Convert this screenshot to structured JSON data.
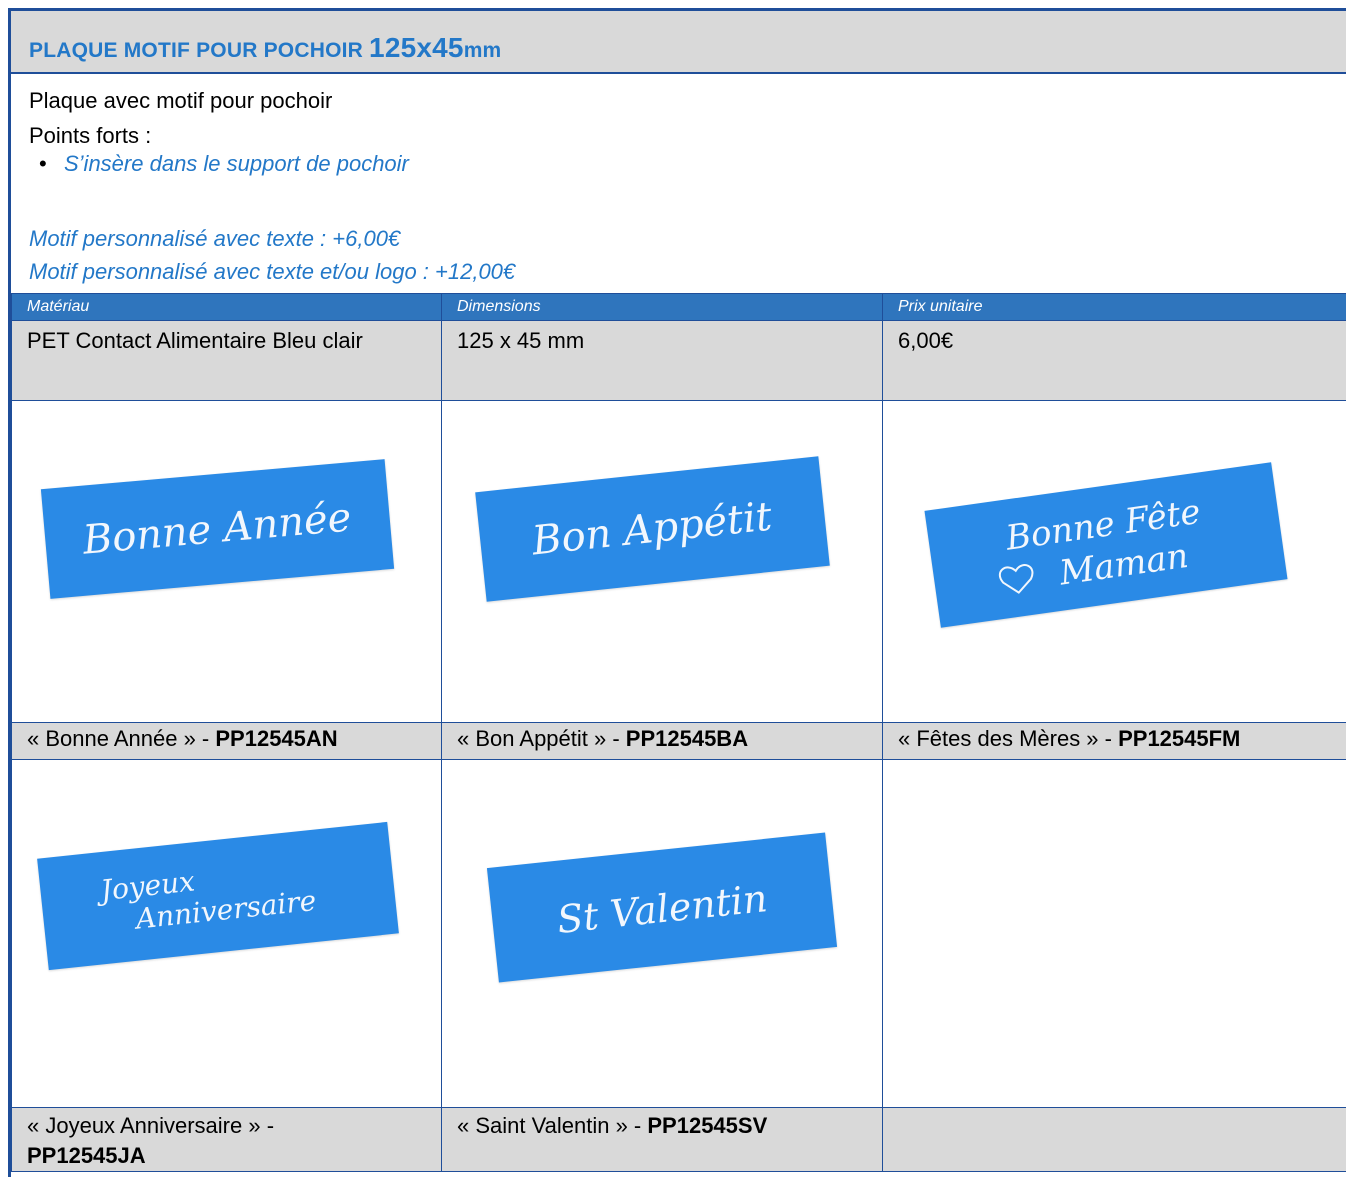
{
  "title": {
    "prefix": "PLAQUE MOTIF POUR POCHOIR ",
    "dims": "125x45",
    "suffix": "mm"
  },
  "intro": {
    "line1": "Plaque avec motif pour pochoir",
    "line2": "Points forts :"
  },
  "bullets": [
    "S’insère dans le support de pochoir"
  ],
  "options": [
    "Motif personnalisé avec texte : +6,00€",
    "Motif personnalisé avec texte et/ou logo : +12,00€"
  ],
  "table": {
    "headers": [
      "Matériau",
      "Dimensions",
      "Prix unitaire"
    ],
    "row": [
      "PET Contact Alimentaire Bleu clair",
      "125 x 45 mm",
      "6,00€"
    ]
  },
  "products": [
    {
      "label": "« Bonne Année » - ",
      "code": "PP12545AN",
      "script": "Bonne Année"
    },
    {
      "label": "« Bon Appétit » - ",
      "code": "PP12545BA",
      "script": "Bon Appétit"
    },
    {
      "label": "« Fêtes des Mères » - ",
      "code": "PP12545FM",
      "script1": "Bonne Fête",
      "script2": "Maman"
    },
    {
      "label": "« Joyeux Anniversaire » - ",
      "code": "PP12545JA",
      "script1": "Joyeux",
      "script2": "Anniversaire"
    },
    {
      "label": "« Saint Valentin » - ",
      "code": "PP12545SV",
      "script": "St Valentin"
    }
  ],
  "colors": {
    "accent": "#2378c8",
    "header_bg": "#2f75bd",
    "stencil": "#2a8ae6",
    "border": "#1f4e99"
  }
}
